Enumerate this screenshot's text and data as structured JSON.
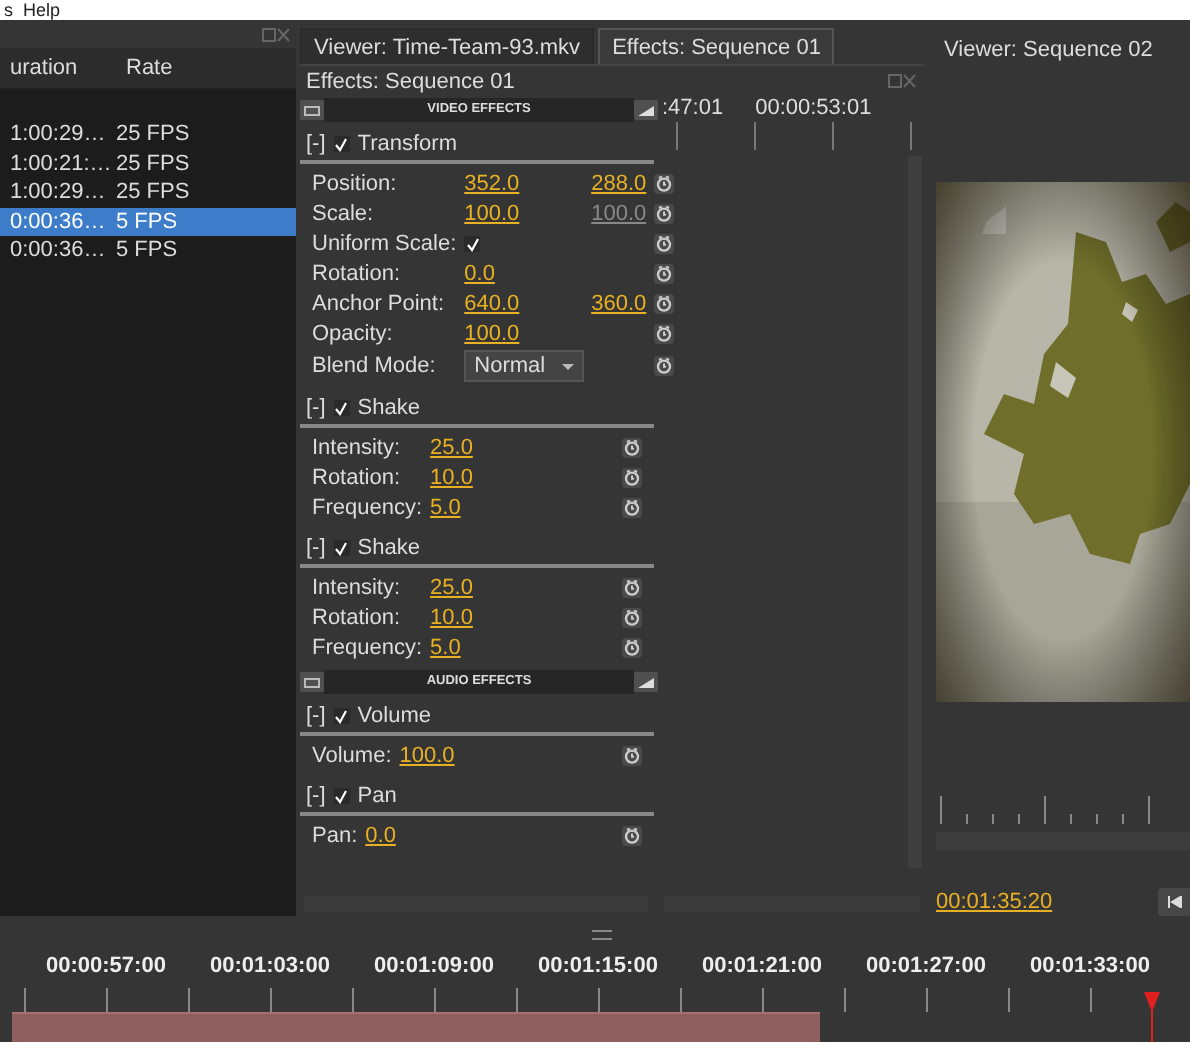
{
  "menu_bar": {
    "items": [
      "s",
      "Help"
    ]
  },
  "media_list": {
    "columns": [
      "uration",
      "Rate"
    ],
    "rows": [
      {
        "duration": "1:00:29…",
        "rate": "25 FPS",
        "selected": false
      },
      {
        "duration": "1:00:21:…",
        "rate": "25 FPS",
        "selected": false
      },
      {
        "duration": "1:00:29…",
        "rate": "25 FPS",
        "selected": false
      },
      {
        "duration": "0:00:36…",
        "rate": "5 FPS",
        "selected": true
      },
      {
        "duration": "0:00:36…",
        "rate": "5 FPS",
        "selected": false
      }
    ]
  },
  "tabs": [
    {
      "label": "Viewer: Time-Team-93.mkv",
      "selected": false
    },
    {
      "label": "Effects: Sequence 01",
      "selected": true
    }
  ],
  "effects_panel": {
    "title": "Effects: Sequence 01",
    "sections": [
      {
        "kind": "header",
        "label": "VIDEO EFFECTS"
      },
      {
        "kind": "effect",
        "name": "Transform",
        "toggle": "[-]",
        "enabled": true,
        "params": [
          {
            "kind": "value",
            "label": "Position:",
            "values": [
              {
                "text": "352.0",
                "disabled": false
              },
              {
                "text": "288.0",
                "disabled": false
              }
            ]
          },
          {
            "kind": "value",
            "label": "Scale:",
            "values": [
              {
                "text": "100.0",
                "disabled": false
              },
              {
                "text": "100.0",
                "disabled": true
              }
            ]
          },
          {
            "kind": "checkbox",
            "label": "Uniform Scale:",
            "checked": true
          },
          {
            "kind": "value",
            "label": "Rotation:",
            "values": [
              {
                "text": "0.0",
                "disabled": false
              }
            ]
          },
          {
            "kind": "value",
            "label": "Anchor Point:",
            "values": [
              {
                "text": "640.0",
                "disabled": false
              },
              {
                "text": "360.0",
                "disabled": false
              }
            ]
          },
          {
            "kind": "value",
            "label": "Opacity:",
            "values": [
              {
                "text": "100.0",
                "disabled": false
              }
            ]
          },
          {
            "kind": "dropdown",
            "label": "Blend Mode:",
            "value": "Normal"
          }
        ]
      },
      {
        "kind": "effect",
        "name": "Shake",
        "toggle": "[-]",
        "enabled": true,
        "params": [
          {
            "kind": "value",
            "label": "Intensity:",
            "values": [
              {
                "text": "25.0",
                "disabled": false
              }
            ]
          },
          {
            "kind": "value",
            "label": "Rotation:",
            "values": [
              {
                "text": "10.0",
                "disabled": false
              }
            ]
          },
          {
            "kind": "value",
            "label": "Frequency:",
            "values": [
              {
                "text": "5.0",
                "disabled": false
              }
            ]
          }
        ]
      },
      {
        "kind": "effect",
        "name": "Shake",
        "toggle": "[-]",
        "enabled": true,
        "params": [
          {
            "kind": "value",
            "label": "Intensity:",
            "values": [
              {
                "text": "25.0",
                "disabled": false
              }
            ]
          },
          {
            "kind": "value",
            "label": "Rotation:",
            "values": [
              {
                "text": "10.0",
                "disabled": false
              }
            ]
          },
          {
            "kind": "value",
            "label": "Frequency:",
            "values": [
              {
                "text": "5.0",
                "disabled": false
              }
            ]
          }
        ]
      },
      {
        "kind": "header",
        "label": "AUDIO EFFECTS"
      },
      {
        "kind": "effect",
        "name": "Volume",
        "toggle": "[-]",
        "enabled": true,
        "params": [
          {
            "kind": "value",
            "label": "Volume:",
            "values": [
              {
                "text": "100.0",
                "disabled": false
              }
            ]
          }
        ]
      },
      {
        "kind": "effect",
        "name": "Pan",
        "toggle": "[-]",
        "enabled": true,
        "params": [
          {
            "kind": "value",
            "label": "Pan:",
            "values": [
              {
                "text": "0.0",
                "disabled": false
              }
            ]
          }
        ]
      }
    ],
    "mini_ruler": {
      "labels": [
        ":47:01",
        "00:00:53:01"
      ]
    }
  },
  "viewer": {
    "title": "Viewer: Sequence 02",
    "timecode": "00:01:35:20"
  },
  "timeline": {
    "labels": [
      "00:00:57:00",
      "00:01:03:00",
      "00:01:09:00",
      "00:01:15:00",
      "00:01:21:00",
      "00:01:27:00",
      "00:01:33:00"
    ]
  }
}
